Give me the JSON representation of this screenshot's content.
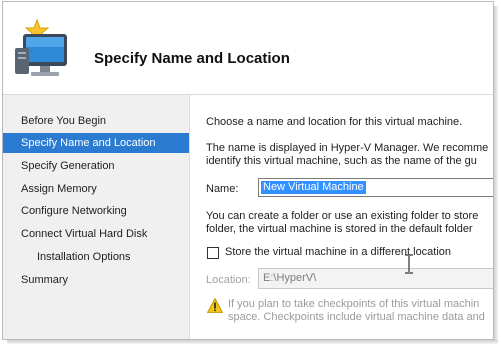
{
  "header": {
    "title": "Specify Name and Location",
    "icon": "virtual-machine-wizard-icon"
  },
  "nav": {
    "items": [
      {
        "label": "Before You Begin",
        "active": false,
        "sub": false
      },
      {
        "label": "Specify Name and Location",
        "active": true,
        "sub": false
      },
      {
        "label": "Specify Generation",
        "active": false,
        "sub": false
      },
      {
        "label": "Assign Memory",
        "active": false,
        "sub": false
      },
      {
        "label": "Configure Networking",
        "active": false,
        "sub": false
      },
      {
        "label": "Connect Virtual Hard Disk",
        "active": false,
        "sub": false
      },
      {
        "label": "Installation Options",
        "active": false,
        "sub": true
      },
      {
        "label": "Summary",
        "active": false,
        "sub": false
      }
    ]
  },
  "main": {
    "intro": "Choose a name and location for this virtual machine.",
    "desc_line1": "The name is displayed in Hyper-V Manager. We recomme",
    "desc_line2": "identify this virtual machine, such as the name of the gu",
    "name_label": "Name:",
    "name_value": "New Virtual Machine",
    "folder_line1": "You can create a folder or use an existing folder to store",
    "folder_line2": "folder, the virtual machine is stored in the default folder",
    "checkbox_label": "Store the virtual machine in a different location",
    "checkbox_checked": false,
    "location_label": "Location:",
    "location_value": "E:\\HyperV\\",
    "warning_line1": "If you plan to take checkpoints of this virtual machin",
    "warning_line2": "space. Checkpoints include virtual machine data and"
  },
  "colors": {
    "accent": "#2a7bd1",
    "selection": "#3391ff",
    "nav_bg": "#f0f0f0",
    "warning": "#f2c515"
  }
}
